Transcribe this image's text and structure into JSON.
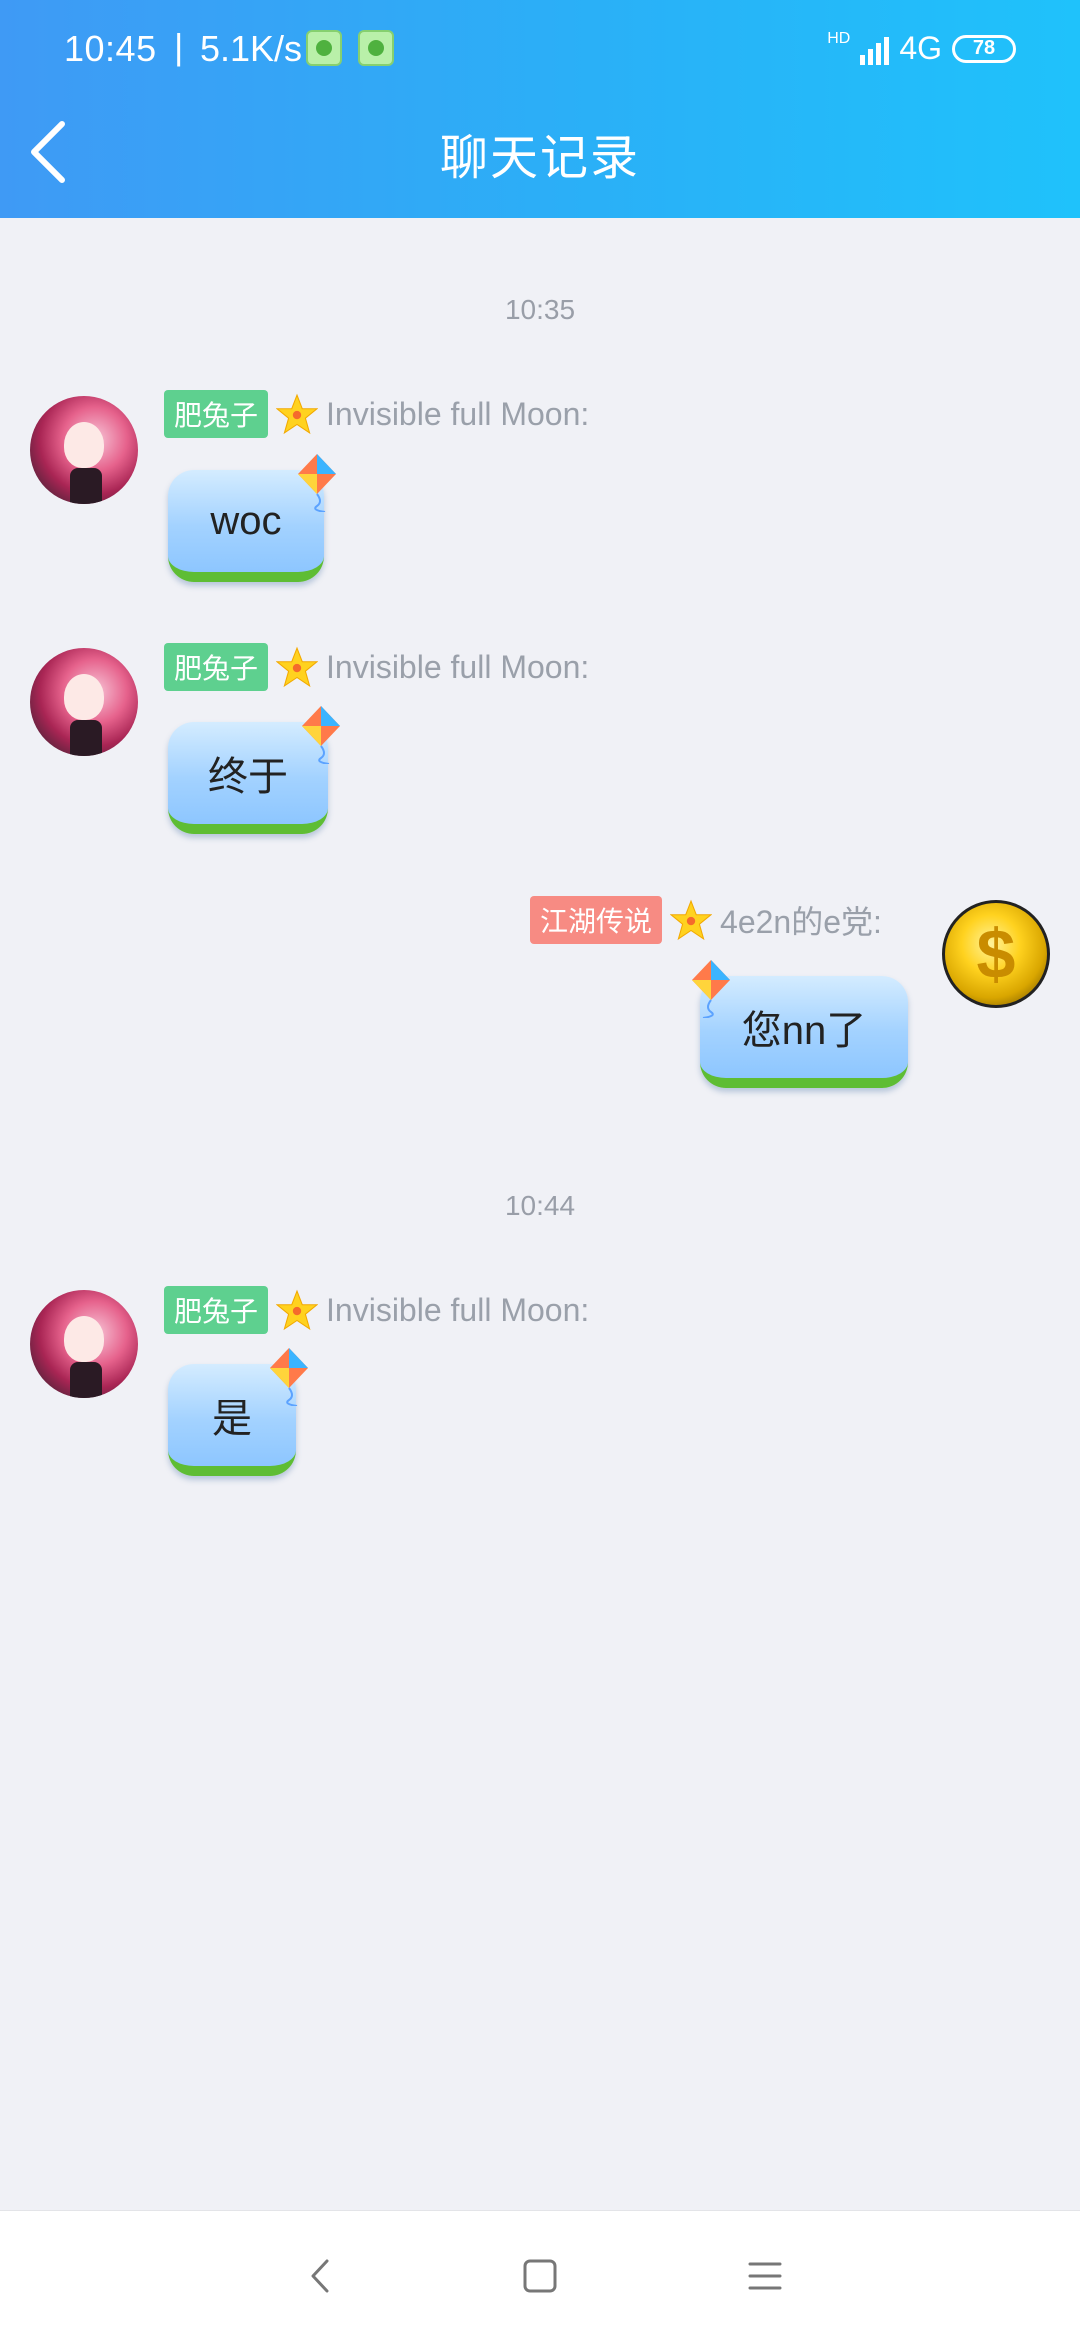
{
  "status": {
    "time": "10:45",
    "separator": "|",
    "speed": "5.1K/s",
    "hd": "HD",
    "network": "4G",
    "battery": "78"
  },
  "header": {
    "title": "聊天记录"
  },
  "chat": {
    "timestamps": [
      "10:35",
      "10:44"
    ],
    "messages": [
      {
        "badge": "肥兔子",
        "sender": "Invisible full Moon:",
        "text": "woc"
      },
      {
        "badge": "肥兔子",
        "sender": "Invisible full Moon:",
        "text": "终于"
      },
      {
        "badge": "江湖传说",
        "sender": "4e2n的e党:",
        "text": "您nn了"
      },
      {
        "badge": "肥兔子",
        "sender": "Invisible full Moon:",
        "text": "是"
      }
    ]
  },
  "colors": {
    "header_start": "#3f9af5",
    "header_end": "#1fc2fb",
    "badge_green": "#5ed08f",
    "badge_red": "#f78b83",
    "background": "#f0f1f6"
  },
  "icons": {
    "back": "chevron-left-icon",
    "star": "star-icon",
    "kite": "kite-icon",
    "nav_back": "nav-back-icon",
    "nav_home": "nav-home-icon",
    "nav_menu": "nav-menu-icon"
  }
}
